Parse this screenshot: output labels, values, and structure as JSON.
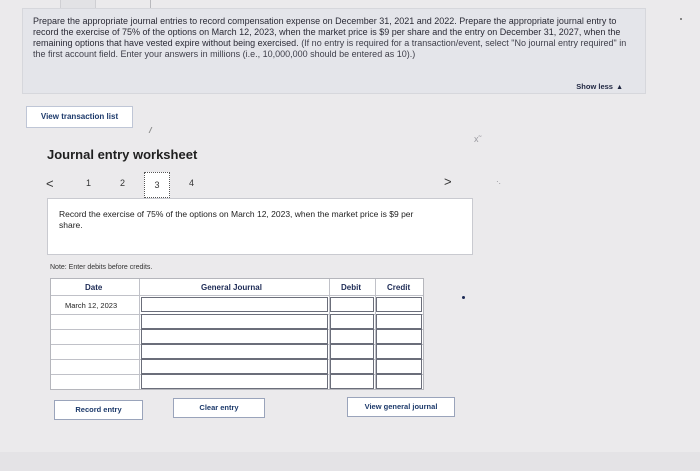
{
  "instructions": {
    "main": "Prepare the appropriate journal entries to record compensation expense on December 31, 2021 and 2022. Prepare the appropriate journal entry to record the exercise of 75% of the options on March 12, 2023, when the market price is $9 per share and the entry on December 31, 2027, when the remaining options that have vested expire without being exercised.",
    "hint": "(If no entry is required for a transaction/event, select \"No journal entry required\" in the first account field. Enter your answers in millions (i.e., 10,000,000 should be entered as 10).)",
    "show_less_label": "Show less",
    "show_less_glyph": "▲"
  },
  "view_transaction_list_label": "View transaction list",
  "worksheet": {
    "title": "Journal entry worksheet",
    "pager": {
      "prev_glyph": "<",
      "next_glyph": ">",
      "pages": [
        "1",
        "2",
        "3",
        "4"
      ],
      "active_page": "3"
    },
    "record_text": "Record the exercise of 75% of the options on March 12, 2023, when the market price is $9 per share.",
    "note": "Note: Enter debits before credits."
  },
  "journal": {
    "headers": {
      "date": "Date",
      "general_journal": "General Journal",
      "debit": "Debit",
      "credit": "Credit"
    },
    "date_value": "March 12, 2023",
    "rows": 6
  },
  "buttons": {
    "record_entry": "Record entry",
    "clear_entry": "Clear entry",
    "view_general_journal": "View general journal"
  },
  "colors": {
    "background": "#ebeaec",
    "button_text": "#1d3a6b",
    "header_text": "#1c2a55"
  }
}
